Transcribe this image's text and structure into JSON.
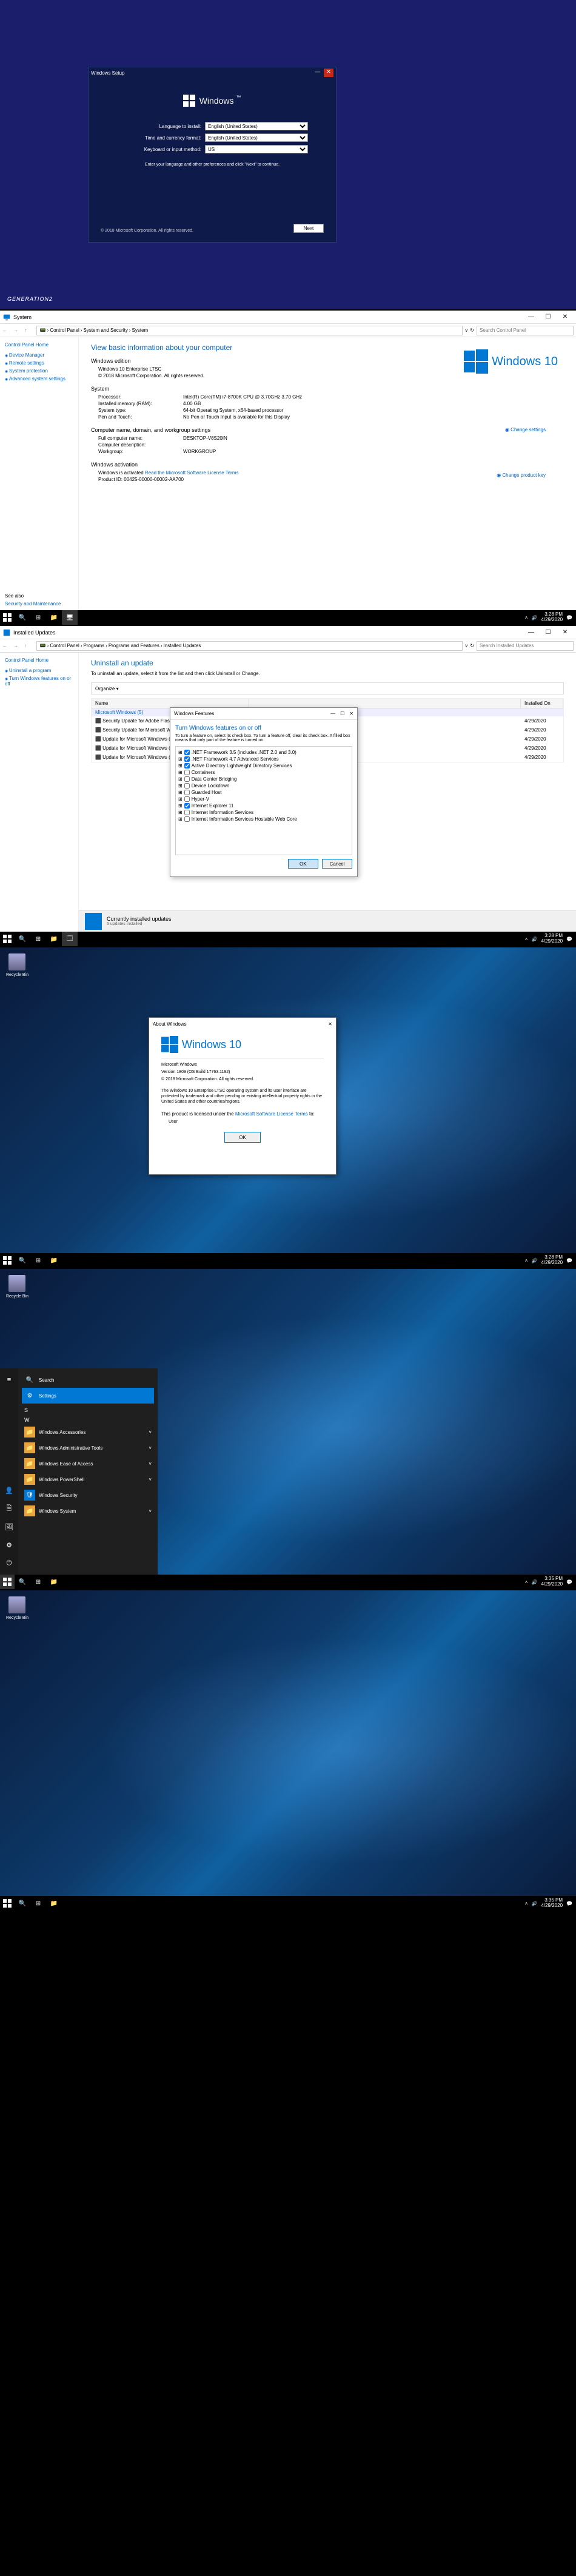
{
  "setup": {
    "window_title": "Windows Setup",
    "brand": "Windows",
    "lang_label": "Language to install:",
    "lang_value": "English (United States)",
    "time_label": "Time and currency format:",
    "time_value": "English (United States)",
    "kb_label": "Keyboard or input method:",
    "kb_value": "US",
    "note": "Enter your language and other preferences and click \"Next\" to continue.",
    "copyright": "© 2018 Microsoft Corporation. All rights reserved.",
    "next_btn": "Next",
    "watermark": "GENERATION2"
  },
  "system": {
    "window_title": "System",
    "breadcrumb": [
      "Control Panel",
      "System and Security",
      "System"
    ],
    "search_placeholder": "Search Control Panel",
    "sidebar_header": "Control Panel Home",
    "sidebar_links": [
      "Device Manager",
      "Remote settings",
      "System protection",
      "Advanced system settings"
    ],
    "heading": "View basic information about your computer",
    "edition_hdr": "Windows edition",
    "edition": "Windows 10 Enterprise LTSC",
    "copyright": "© 2018 Microsoft Corporation. All rights reserved.",
    "brand": "Windows 10",
    "sys_hdr": "System",
    "processor_k": "Processor:",
    "processor_v": "Intel(R) Core(TM) i7-8700K CPU @ 3.70GHz   3.70 GHz",
    "ram_k": "Installed memory (RAM):",
    "ram_v": "4.00 GB",
    "type_k": "System type:",
    "type_v": "64-bit Operating System, x64-based processor",
    "pen_k": "Pen and Touch:",
    "pen_v": "No Pen or Touch Input is available for this Display",
    "dom_hdr": "Computer name, domain, and workgroup settings",
    "cname_k": "Full computer name:",
    "cname_v": "DESKTOP-V8S20IN",
    "cdesc_k": "Computer description:",
    "wg_k": "Workgroup:",
    "wg_v": "WORKGROUP",
    "act_hdr": "Windows activation",
    "act_status": "Windows is activated   ",
    "act_link": "Read the Microsoft Software License Terms",
    "pid_k": "Product ID: 00425-00000-00002-AA700",
    "change_settings": "Change settings",
    "change_pkey": "Change product key",
    "seealso_hdr": "See also",
    "seealso_link": "Security and Maintenance"
  },
  "updates": {
    "window_title": "Installed Updates",
    "breadcrumb": [
      "Control Panel",
      "Programs",
      "Programs and Features",
      "Installed Updates"
    ],
    "search_placeholder": "Search Installed Updates",
    "sidebar_header": "Control Panel Home",
    "sidebar_links": [
      "Uninstall a program",
      "Turn Windows features on or off"
    ],
    "heading": "Uninstall an update",
    "sub": "To uninstall an update, select it from the list and then click Uninstall or Change.",
    "organize": "Organize ▾",
    "col_name": "Name",
    "col_installed": "Installed On",
    "group": "Microsoft Windows (5)",
    "rows": [
      {
        "name": "Security Update for Adobe Flash Player",
        "date": "4/29/2020"
      },
      {
        "name": "Security Update for Microsoft Windows (KB4549947)",
        "date": "4/29/2020"
      },
      {
        "name": "Update for Microsoft Windows (KB4486153)",
        "date": "4/29/2020"
      },
      {
        "name": "Update for Microsoft Windows (KB4023057489)",
        "date": "4/29/2020"
      },
      {
        "name": "Update for Microsoft Windows (KB4550969)",
        "date": "4/29/2020"
      }
    ],
    "footer_title": "Currently installed updates",
    "footer_sub": "5 updates installed"
  },
  "features": {
    "title": "Windows Features",
    "heading": "Turn Windows features on or off",
    "note": "To turn a feature on, select its check box. To turn a feature off, clear its check box. A filled box means that only part of the feature is turned on.",
    "items": [
      ".NET Framework 3.5 (includes .NET 2.0 and 3.0)",
      ".NET Framework 4.7 Advanced Services",
      "Active Directory Lightweight Directory Services",
      "Containers",
      "Data Center Bridging",
      "Device Lockdown",
      "Guarded Host",
      "Hyper-V",
      "Internet Explorer 11",
      "Internet Information Services",
      "Internet Information Services Hostable Web Core"
    ],
    "ok": "OK",
    "cancel": "Cancel"
  },
  "about": {
    "title": "About Windows",
    "brand": "Windows 10",
    "line1": "Microsoft Windows",
    "line2": "Version 1809 (OS Build 17763.1192)",
    "line3": "© 2018 Microsoft Corporation. All rights reserved.",
    "para": "The Windows 10 Enterprise LTSC operating system and its user interface are protected by trademark and other pending or existing intellectual property rights in the United States and other countries/regions.",
    "license_pre": "This product is licensed under the ",
    "license_link": "Microsoft Software License Terms",
    "license_post": " to:",
    "user": "User",
    "ok": "OK"
  },
  "start": {
    "search": "Search",
    "settings": "Settings",
    "letters": {
      "S": "S",
      "W": "W"
    },
    "apps": [
      {
        "letter": "S",
        "icon": "⚙",
        "name": "Settings",
        "bg": "#0078d4"
      },
      {
        "letter": "W",
        "icon": "📁",
        "name": "Windows Accessories",
        "exp": true,
        "bg": "#e8a33d"
      },
      {
        "letter": "",
        "icon": "📁",
        "name": "Windows Administrative Tools",
        "exp": true,
        "bg": "#e8a33d"
      },
      {
        "letter": "",
        "icon": "📁",
        "name": "Windows Ease of Access",
        "exp": true,
        "bg": "#e8a33d"
      },
      {
        "letter": "",
        "icon": "📁",
        "name": "Windows PowerShell",
        "exp": true,
        "bg": "#e8a33d"
      },
      {
        "letter": "",
        "icon": "🛡",
        "name": "Windows Security",
        "bg": "#0078d4"
      },
      {
        "letter": "",
        "icon": "📁",
        "name": "Windows System",
        "exp": true,
        "bg": "#e8a33d"
      }
    ]
  },
  "recycle_label": "Recycle Bin",
  "clock": {
    "time": "3:28 PM",
    "date": "4/29/2020"
  },
  "clock2": {
    "time": "3:35 PM",
    "date": "4/29/2020"
  }
}
